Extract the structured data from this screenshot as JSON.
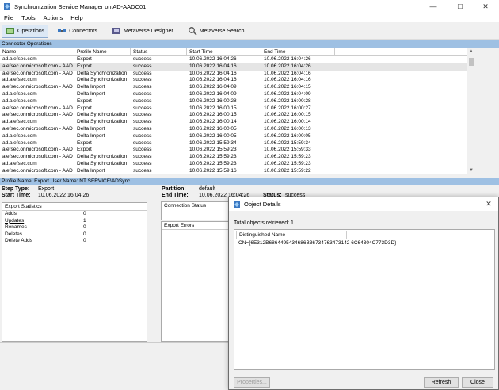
{
  "window": {
    "title": "Synchronization Service Manager on AD-AADC01",
    "minimize": "—",
    "maximize": "☐",
    "close": "✕"
  },
  "menu": [
    "File",
    "Tools",
    "Actions",
    "Help"
  ],
  "toolbar": [
    {
      "label": "Operations",
      "icon": "operations-icon",
      "active": true
    },
    {
      "label": "Connectors",
      "icon": "connectors-icon",
      "active": false
    },
    {
      "label": "Metaverse Designer",
      "icon": "metaverse-designer-icon",
      "active": false
    },
    {
      "label": "Metaverse Search",
      "icon": "metaverse-search-icon",
      "active": false
    }
  ],
  "section_title": "Connector Operations",
  "grid": {
    "columns": [
      "Name",
      "Profile Name",
      "Status",
      "Start Time",
      "End Time"
    ],
    "rows": [
      [
        "ad.alefsec.com",
        "Export",
        "success",
        "10.06.2022 16:04:26",
        "10.06.2022 16:04:26"
      ],
      [
        "alefsec.onmicrosoft.com - AAD",
        "Export",
        "success",
        "10.06.2022 16:04:16",
        "10.06.2022 16:04:26"
      ],
      [
        "alefsec.onmicrosoft.com - AAD",
        "Delta Synchronization",
        "success",
        "10.06.2022 16:04:16",
        "10.06.2022 16:04:16"
      ],
      [
        "ad.alefsec.com",
        "Delta Synchronization",
        "success",
        "10.06.2022 16:04:16",
        "10.06.2022 16:04:16"
      ],
      [
        "alefsec.onmicrosoft.com - AAD",
        "Delta Import",
        "success",
        "10.06.2022 16:04:09",
        "10.06.2022 16:04:15"
      ],
      [
        "ad.alefsec.com",
        "Delta Import",
        "success",
        "10.06.2022 16:04:09",
        "10.06.2022 16:04:09"
      ],
      [
        "ad.alefsec.com",
        "Export",
        "success",
        "10.06.2022 16:00:28",
        "10.06.2022 16:00:28"
      ],
      [
        "alefsec.onmicrosoft.com - AAD",
        "Export",
        "success",
        "10.06.2022 16:00:15",
        "10.06.2022 16:00:27"
      ],
      [
        "alefsec.onmicrosoft.com - AAD",
        "Delta Synchronization",
        "success",
        "10.06.2022 16:00:15",
        "10.06.2022 16:00:15"
      ],
      [
        "ad.alefsec.com",
        "Delta Synchronization",
        "success",
        "10.06.2022 16:00:14",
        "10.06.2022 16:00:14"
      ],
      [
        "alefsec.onmicrosoft.com - AAD",
        "Delta Import",
        "success",
        "10.06.2022 16:00:05",
        "10.06.2022 16:00:13"
      ],
      [
        "ad.alefsec.com",
        "Delta Import",
        "success",
        "10.06.2022 16:00:05",
        "10.06.2022 16:00:05"
      ],
      [
        "ad.alefsec.com",
        "Export",
        "success",
        "10.06.2022 15:59:34",
        "10.06.2022 15:59:34"
      ],
      [
        "alefsec.onmicrosoft.com - AAD",
        "Export",
        "success",
        "10.06.2022 15:59:23",
        "10.06.2022 15:59:33"
      ],
      [
        "alefsec.onmicrosoft.com - AAD",
        "Delta Synchronization",
        "success",
        "10.06.2022 15:59:23",
        "10.06.2022 15:59:23"
      ],
      [
        "ad.alefsec.com",
        "Delta Synchronization",
        "success",
        "10.06.2022 15:59:23",
        "10.06.2022 15:59:23"
      ],
      [
        "alefsec.onmicrosoft.com - AAD",
        "Delta Import",
        "success",
        "10.06.2022 15:59:16",
        "10.06.2022 15:59:22"
      ],
      [
        "ad.alefsec.com",
        "Delta Import",
        "success",
        "10.06.2022 15:59:16",
        "10.06.2022 15:59:16"
      ]
    ]
  },
  "profile_bar": "Profile Name: Export  User Name: NT SERVICE\\ADSync",
  "details": {
    "step_type_label": "Step Type:",
    "step_type": "Export",
    "start_time_label": "Start Time:",
    "start_time": "10.06.2022 16:04:26",
    "partition_label": "Partition:",
    "partition": "default",
    "end_time_label": "End Time:",
    "end_time": "10.06.2022 16:04:26",
    "status_label": "Status:",
    "status": "success"
  },
  "export_stats": {
    "header": "Export Statistics",
    "rows": [
      {
        "k": "Adds",
        "v": "0"
      },
      {
        "k": "Updates",
        "v": "1"
      },
      {
        "k": "Renames",
        "v": "0"
      },
      {
        "k": "Deletes",
        "v": "0"
      },
      {
        "k": "Delete Adds",
        "v": "0"
      }
    ]
  },
  "connection_status": "Connection Status",
  "export_errors": "Export Errors",
  "dialog": {
    "title": "Object Details",
    "total": "Total objects retrieved: 1",
    "column": "Distinguished Name",
    "row": "CN={6E312B6864495434686B36734763473142 6C64304C773D3D}",
    "properties": "Properties...",
    "refresh": "Refresh",
    "close": "Close"
  }
}
